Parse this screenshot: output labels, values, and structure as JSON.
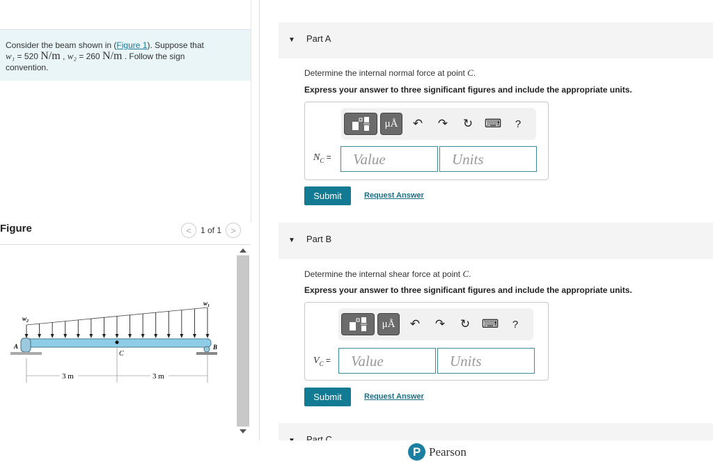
{
  "prompt": {
    "t1": "Consider the beam shown in (",
    "link": "Figure 1",
    "t2": "). Suppose that",
    "w1": "w₁",
    "eq1": " = 520 ",
    "unit": "N/m",
    "sep": " , ",
    "w2": "w₂",
    "eq2": " = 260 ",
    "t3": " . Follow the sign",
    "t4": "convention."
  },
  "figure": {
    "heading": "Figure",
    "pager": "1 of 1",
    "prev": "<",
    "next": ">",
    "labels": {
      "w1": "w",
      "w1sub": "1",
      "w2": "w",
      "w2sub": "2",
      "A": "A",
      "B": "B",
      "C": "C",
      "d1": "3 m",
      "d2": "3 m"
    }
  },
  "toolbar": {
    "templates_icon": "fraction-template-icon",
    "units_label": "μÅ",
    "undo": "↶",
    "redo": "↷",
    "reset": "↻",
    "keyboard": "⌨",
    "help": "?"
  },
  "parts": [
    {
      "title": "Part A",
      "question": "Determine the internal normal force at point ",
      "point": "C",
      "tail": ".",
      "instruction": "Express your answer to three significant figures and include the appropriate units.",
      "var": "N",
      "sub": "C",
      "eq": " =",
      "value_placeholder": "Value",
      "units_placeholder": "Units",
      "submit": "Submit",
      "request": "Request Answer"
    },
    {
      "title": "Part B",
      "question": "Determine the internal shear force at point ",
      "point": "C",
      "tail": ".",
      "instruction": "Express your answer to three significant figures and include the appropriate units.",
      "var": "V",
      "sub": "C",
      "eq": " =",
      "value_placeholder": "Value",
      "units_placeholder": "Units",
      "submit": "Submit",
      "request": "Request Answer"
    },
    {
      "title": "Part C"
    }
  ],
  "footer": {
    "logo_letter": "P",
    "brand": "Pearson"
  }
}
